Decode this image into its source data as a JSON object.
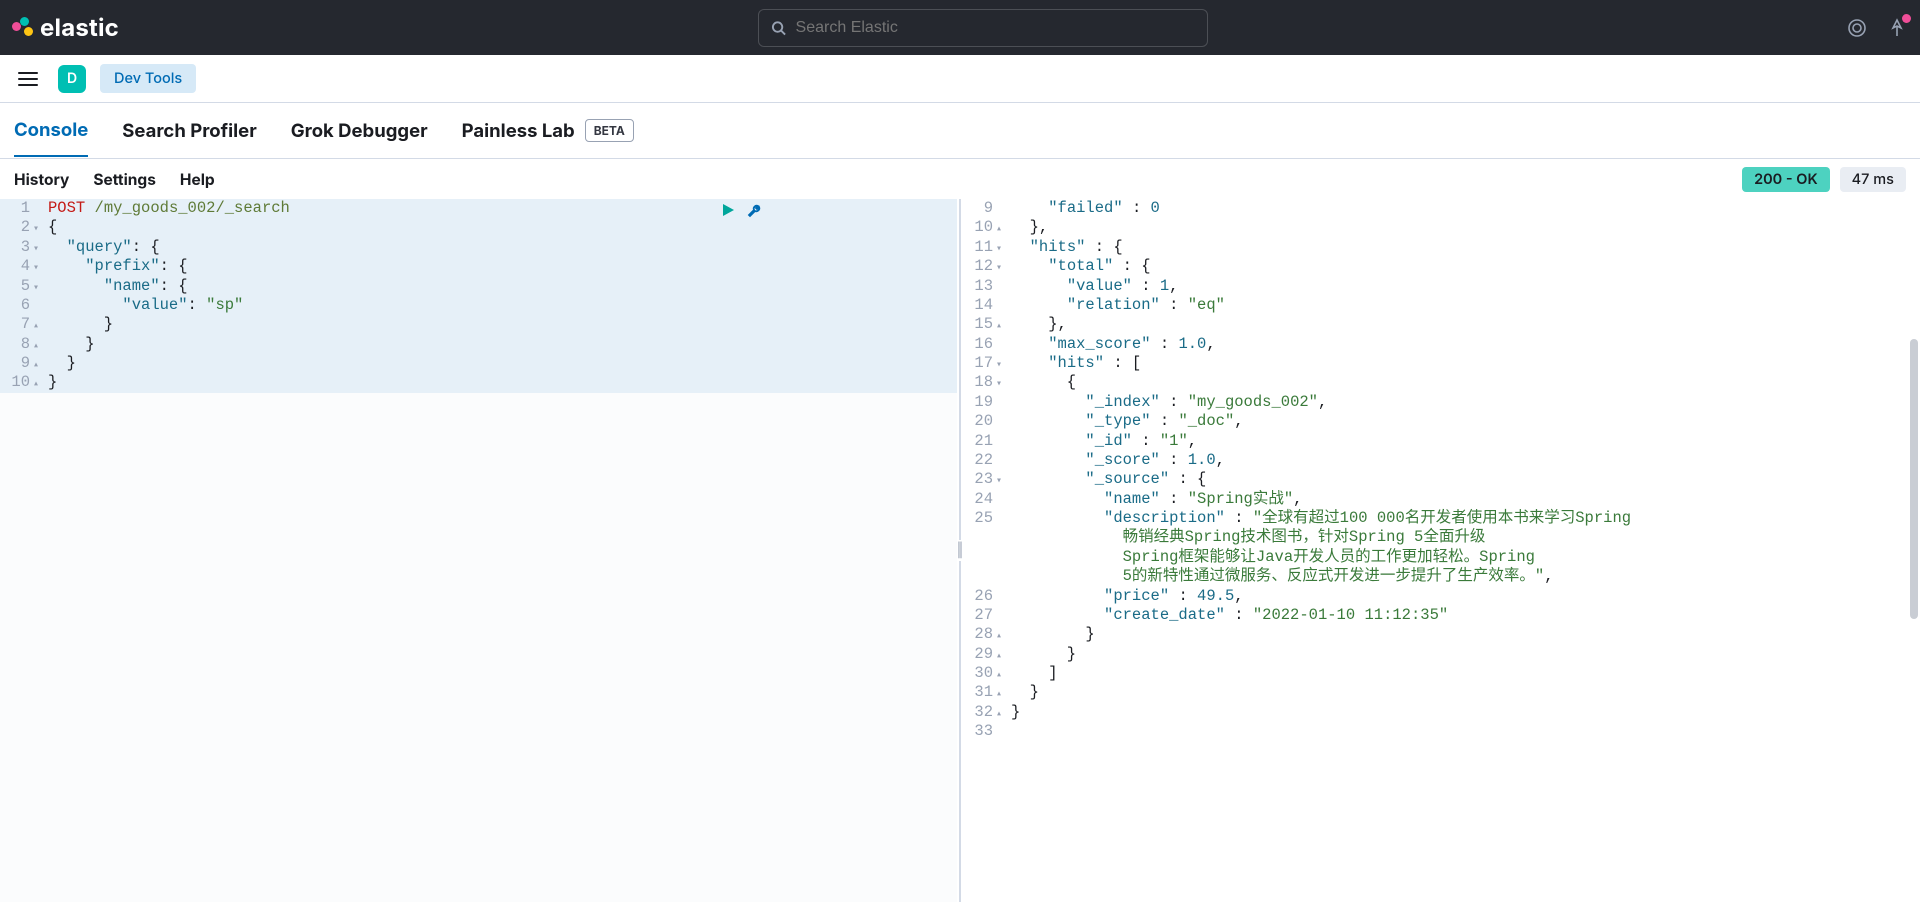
{
  "header": {
    "brand": "elastic",
    "search_placeholder": "Search Elastic",
    "space_initial": "D",
    "app_label": "Dev Tools"
  },
  "tabs": [
    {
      "label": "Console",
      "active": true
    },
    {
      "label": "Search Profiler"
    },
    {
      "label": "Grok Debugger"
    },
    {
      "label": "Painless Lab",
      "badge": "BETA"
    }
  ],
  "tool_links": [
    "History",
    "Settings",
    "Help"
  ],
  "status": {
    "ok": "200 - OK",
    "ms": "47 ms"
  },
  "request": {
    "lines": [
      {
        "n": "1",
        "fold": "",
        "html": "<span class='kw'>POST</span> <span class='path'>/my_goods_002/_search</span>",
        "hl": true
      },
      {
        "n": "2",
        "fold": "▾",
        "html": "{",
        "hl": true
      },
      {
        "n": "3",
        "fold": "▾",
        "html": "  <span class='key'>\"query\"</span>: {",
        "hl": true
      },
      {
        "n": "4",
        "fold": "▾",
        "html": "    <span class='key'>\"prefix\"</span>: {",
        "hl": true
      },
      {
        "n": "5",
        "fold": "▾",
        "html": "      <span class='key'>\"name\"</span>: {",
        "hl": true
      },
      {
        "n": "6",
        "fold": "",
        "html": "        <span class='key'>\"value\"</span>: <span class='str'>\"sp\"</span>",
        "hl": true,
        "caret": true,
        "sel": true
      },
      {
        "n": "7",
        "fold": "▴",
        "html": "      }",
        "hl": true
      },
      {
        "n": "8",
        "fold": "▴",
        "html": "    }",
        "hl": true
      },
      {
        "n": "9",
        "fold": "▴",
        "html": "  }",
        "hl": true
      },
      {
        "n": "10",
        "fold": "▴",
        "html": "}",
        "hl": true
      }
    ]
  },
  "response": {
    "lines": [
      {
        "n": "9",
        "fold": "",
        "html": "    <span class='key'>\"failed\"</span> : <span class='num'>0</span>"
      },
      {
        "n": "10",
        "fold": "▴",
        "html": "  },"
      },
      {
        "n": "11",
        "fold": "▾",
        "html": "  <span class='key'>\"hits\"</span> : {"
      },
      {
        "n": "12",
        "fold": "▾",
        "html": "    <span class='key'>\"total\"</span> : {"
      },
      {
        "n": "13",
        "fold": "",
        "html": "      <span class='key'>\"value\"</span> : <span class='num'>1</span>,"
      },
      {
        "n": "14",
        "fold": "",
        "html": "      <span class='key'>\"relation\"</span> : <span class='str'>\"eq\"</span>"
      },
      {
        "n": "15",
        "fold": "▴",
        "html": "    },"
      },
      {
        "n": "16",
        "fold": "",
        "html": "    <span class='key'>\"max_score\"</span> : <span class='num'>1.0</span>,"
      },
      {
        "n": "17",
        "fold": "▾",
        "html": "    <span class='key'>\"hits\"</span> : ["
      },
      {
        "n": "18",
        "fold": "▾",
        "html": "      {"
      },
      {
        "n": "19",
        "fold": "",
        "html": "        <span class='key'>\"_index\"</span> : <span class='str'>\"my_goods_002\"</span>,"
      },
      {
        "n": "20",
        "fold": "",
        "html": "        <span class='key'>\"_type\"</span> : <span class='str'>\"_doc\"</span>,"
      },
      {
        "n": "21",
        "fold": "",
        "html": "        <span class='key'>\"_id\"</span> : <span class='str'>\"1\"</span>,"
      },
      {
        "n": "22",
        "fold": "",
        "html": "        <span class='key'>\"_score\"</span> : <span class='num'>1.0</span>,"
      },
      {
        "n": "23",
        "fold": "▾",
        "html": "        <span class='key'>\"_source\"</span> : {"
      },
      {
        "n": "24",
        "fold": "",
        "html": "          <span class='key'>\"name\"</span> : <span class='str'>\"Spring实战\"</span>,"
      },
      {
        "n": "25",
        "fold": "",
        "html": "          <span class='key'>\"description\"</span> : <span class='str'>\"全球有超过100 000名开发者使用本书来学习Spring</span>"
      },
      {
        "n": "",
        "fold": "",
        "html": "            <span class='str'>畅销经典Spring技术图书，针对Spring 5全面升级</span>"
      },
      {
        "n": "",
        "fold": "",
        "html": "            <span class='str'>Spring框架能够让Java开发人员的工作更加轻松。Spring</span>"
      },
      {
        "n": "",
        "fold": "",
        "html": "            <span class='str'>5的新特性通过微服务、反应式开发进一步提升了生产效率。\"</span>,"
      },
      {
        "n": "26",
        "fold": "",
        "html": "          <span class='key'>\"price\"</span> : <span class='num'>49.5</span>,"
      },
      {
        "n": "27",
        "fold": "",
        "html": "          <span class='key'>\"create_date\"</span> : <span class='str'>\"2022-01-10 11:12:35\"</span>"
      },
      {
        "n": "28",
        "fold": "▴",
        "html": "        }"
      },
      {
        "n": "29",
        "fold": "▴",
        "html": "      }"
      },
      {
        "n": "30",
        "fold": "▴",
        "html": "    ]"
      },
      {
        "n": "31",
        "fold": "▴",
        "html": "  }"
      },
      {
        "n": "32",
        "fold": "▴",
        "html": "}"
      },
      {
        "n": "33",
        "fold": "",
        "html": ""
      }
    ]
  }
}
